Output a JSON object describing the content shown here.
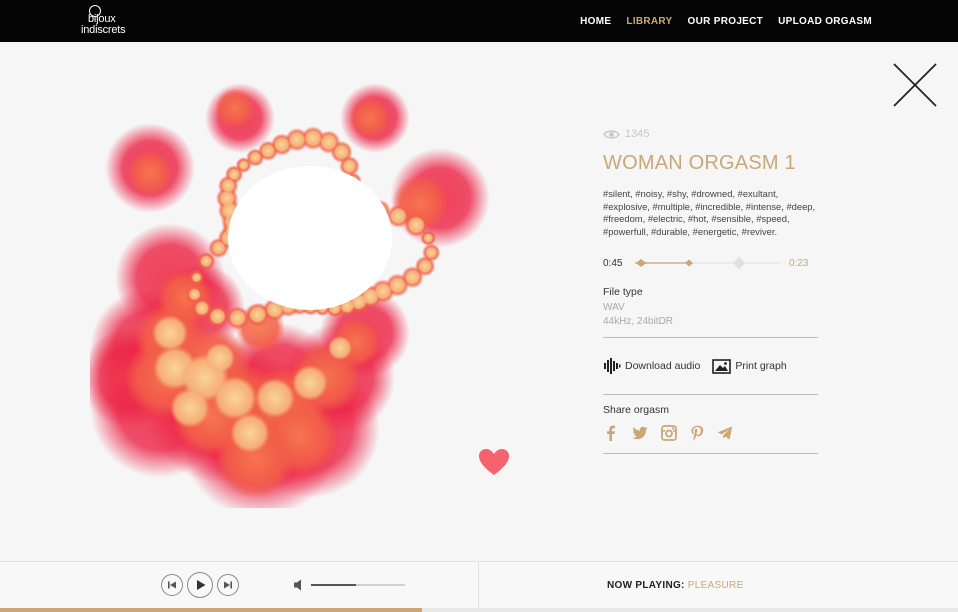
{
  "brand": {
    "line1": "bijoux",
    "line2": "indiscrets"
  },
  "nav": {
    "items": [
      {
        "label": "HOME",
        "active": false
      },
      {
        "label": "LIBRARY",
        "active": true
      },
      {
        "label": "OUR PROJECT",
        "active": false
      },
      {
        "label": "UPLOAD ORGASM",
        "active": false
      }
    ]
  },
  "track": {
    "views": "1345",
    "title": "WOMAN ORGASM 1",
    "tags": "#silent, #noisy, #shy, #drowned, #exultant, #explosive, #multiple, #incredible, #intense, #deep, #freedom, #electric, #hot, #sensible, #speed, #powerfull, #durable, #energetic, #reviver.",
    "time_elapsed": "0:45",
    "time_remaining": "0:23",
    "file_type_label": "File type",
    "file_format": "WAV",
    "file_quality": "44kHz, 24bitDR"
  },
  "actions": {
    "download": "Download audio",
    "print": "Print graph"
  },
  "share": {
    "label": "Share orgasm",
    "networks": [
      "facebook",
      "twitter",
      "instagram",
      "pinterest",
      "telegram"
    ]
  },
  "player": {
    "now_playing_label": "NOW PLAYING:",
    "now_playing_track": "PLEASURE",
    "volume": 0.48,
    "progress": 0.44
  },
  "colors": {
    "accent": "#c9a778",
    "heart": "#f4636e",
    "viz_red": "#e8213f",
    "viz_orange": "#f47a4a",
    "viz_peach": "#f7c48a"
  },
  "icons": {
    "close": "close-icon",
    "eye": "eye-icon",
    "heart": "heart-icon",
    "download": "audio-waveform-icon",
    "print": "image-icon",
    "volume": "speaker-icon"
  }
}
